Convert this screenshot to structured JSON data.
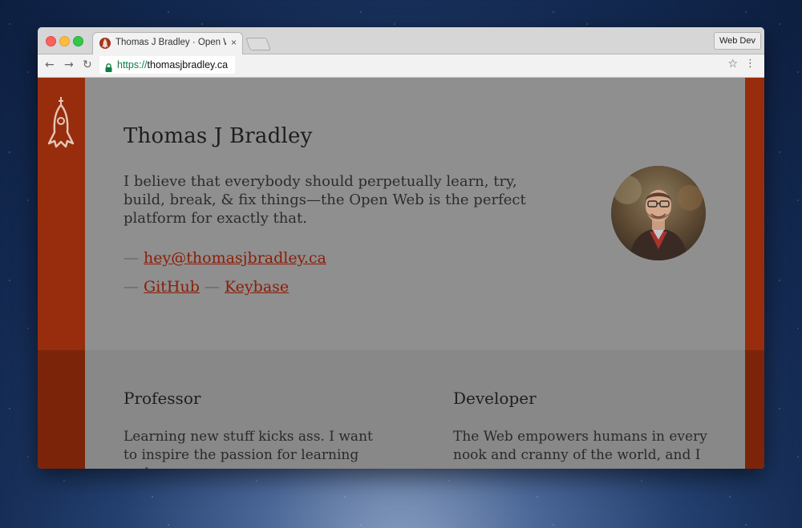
{
  "browser": {
    "tab": {
      "title": "Thomas J Bradley · Open Web",
      "close_icon": "×"
    },
    "profile_label": "Web Dev",
    "address": {
      "scheme": "https://",
      "host": "thomasjbradley.ca"
    },
    "icons": {
      "back": "←",
      "forward": "→",
      "reload": "↻",
      "bookmark": "☆",
      "menu": "⋮"
    }
  },
  "page": {
    "name": "Thomas J Bradley",
    "intro": "I believe that everybody should perpetually learn, try, build, break, & fix things—the Open Web is the perfect platform for exactly that.",
    "dash": "—",
    "email": "hey@thomasjbradley.ca",
    "links": [
      "GitHub",
      "Keybase"
    ],
    "sections": [
      {
        "title": "Professor",
        "text": "Learning new stuff kicks ass. I want to inspire the passion for learning and"
      },
      {
        "title": "Developer",
        "text": "The Web empowers humans in every nook and cranny of the world, and I"
      }
    ]
  },
  "colors": {
    "accent_rail": "#982d0d",
    "link": "#8c1c06",
    "secure_green": "#0b8043"
  }
}
